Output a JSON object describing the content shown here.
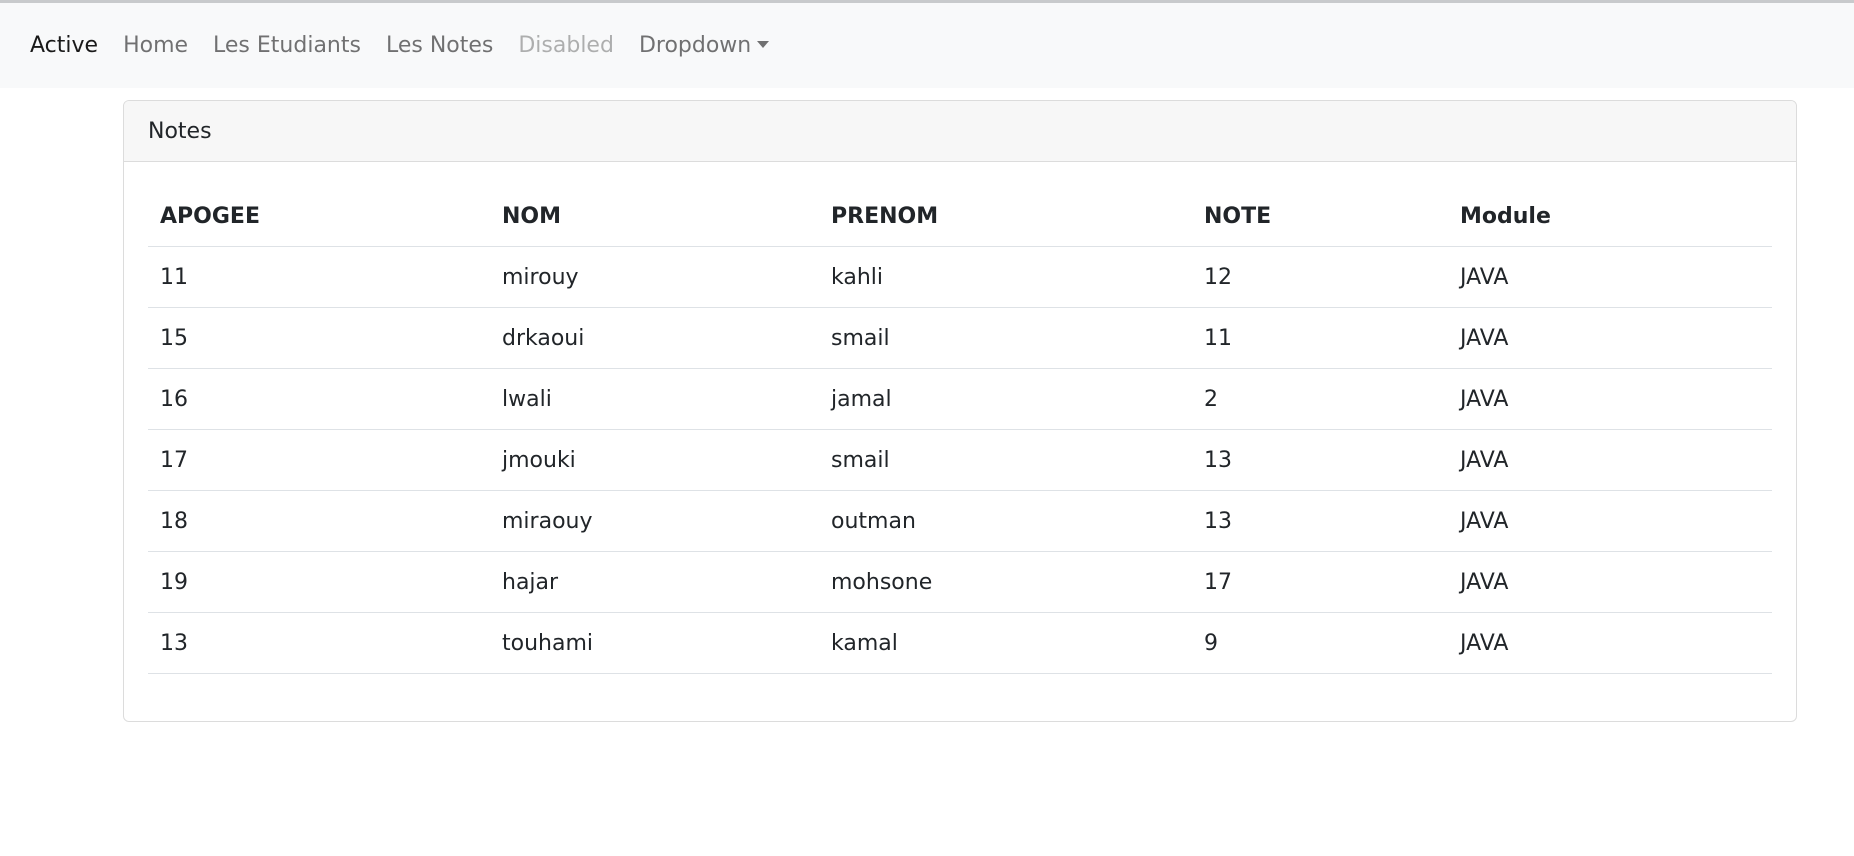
{
  "nav": {
    "items": [
      {
        "label": "Active",
        "state": "active"
      },
      {
        "label": "Home",
        "state": "normal"
      },
      {
        "label": "Les Etudiants",
        "state": "normal"
      },
      {
        "label": "Les Notes",
        "state": "normal"
      },
      {
        "label": "Disabled",
        "state": "disabled"
      },
      {
        "label": "Dropdown",
        "state": "dropdown"
      }
    ]
  },
  "card": {
    "title": "Notes"
  },
  "table": {
    "headers": [
      "APOGEE",
      "NOM",
      "PRENOM",
      "NOTE",
      "Module"
    ],
    "rows": [
      [
        "11",
        "mirouy",
        "kahli",
        "12",
        "JAVA"
      ],
      [
        "15",
        "drkaoui",
        "smail",
        "11",
        "JAVA"
      ],
      [
        "16",
        "lwali",
        "jamal",
        "2",
        "JAVA"
      ],
      [
        "17",
        "jmouki",
        "smail",
        "13",
        "JAVA"
      ],
      [
        "18",
        "miraouy",
        "outman",
        "13",
        "JAVA"
      ],
      [
        "19",
        "hajar",
        "mohsone",
        "17",
        "JAVA"
      ],
      [
        "13",
        "touhami",
        "kamal",
        "9",
        "JAVA"
      ]
    ]
  }
}
